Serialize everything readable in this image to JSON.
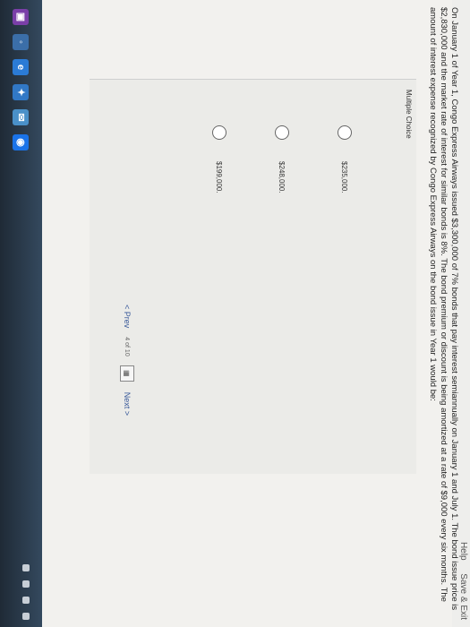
{
  "header": {
    "help": "Help",
    "save_exit": "Save & Exit"
  },
  "question": {
    "text": "On January 1 of Year 1, Congo Express Airways issued $3,300,000 of 7% bonds that pay interest semiannually on January 1 and July 1. The bond issue price is $2,830,000 and the market rate of interest for similar bonds is 8%. The bond premium or discount is being amortized at a rate of $9,000 every six months. The amount of interest expense recognized by Congo Express Airways on the bond issue in Year 1 would be:"
  },
  "multiple_choice": {
    "title": "Multiple Choice",
    "options": [
      {
        "label": "$235,000."
      },
      {
        "label": "$248,000."
      },
      {
        "label": "$199,000."
      }
    ]
  },
  "pager": {
    "prev": "< Prev",
    "current": "4",
    "of": "of",
    "total": "10",
    "next": "Next >"
  },
  "taskbar": {
    "icons": [
      "start-icon",
      "store-icon",
      "edge-icon",
      "dropbox-icon",
      "mail-icon",
      "chrome-icon"
    ]
  }
}
